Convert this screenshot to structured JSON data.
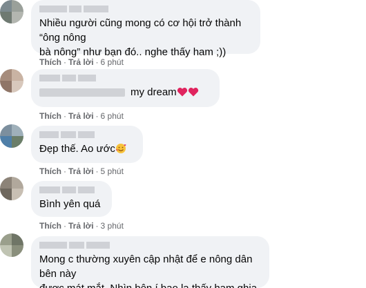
{
  "comments": [
    {
      "text": "Nhiều người cũng mong có cơ hội trở thành “ông nông\nbà nông” như bạn đó.. nghe thấy ham ;))",
      "like": "Thích",
      "reply": "Trả lời",
      "time": "6 phút"
    },
    {
      "text": "my dream",
      "like": "Thích",
      "reply": "Trả lời",
      "time": "6 phút"
    },
    {
      "text": "Đẹp thế. Ao ước",
      "like": "Thích",
      "reply": "Trả lời",
      "time": "5 phút"
    },
    {
      "text": "Bình yên quá",
      "like": "Thích",
      "reply": "Trả lời",
      "time": "3 phút"
    },
    {
      "text": "Mong c thường xuyên cập nhật để e nông dân bên này\nđược mát mắt. Nhìn bên í bao la thấy ham ghia"
    }
  ],
  "separator": "·",
  "icons": {
    "heart": "red-heart-icon",
    "smiling_hearts": "smiling-face-with-hearts-icon"
  },
  "colors": {
    "bubble": "#f0f2f5",
    "meta_text": "#65676b",
    "heart": "#e0245e"
  }
}
